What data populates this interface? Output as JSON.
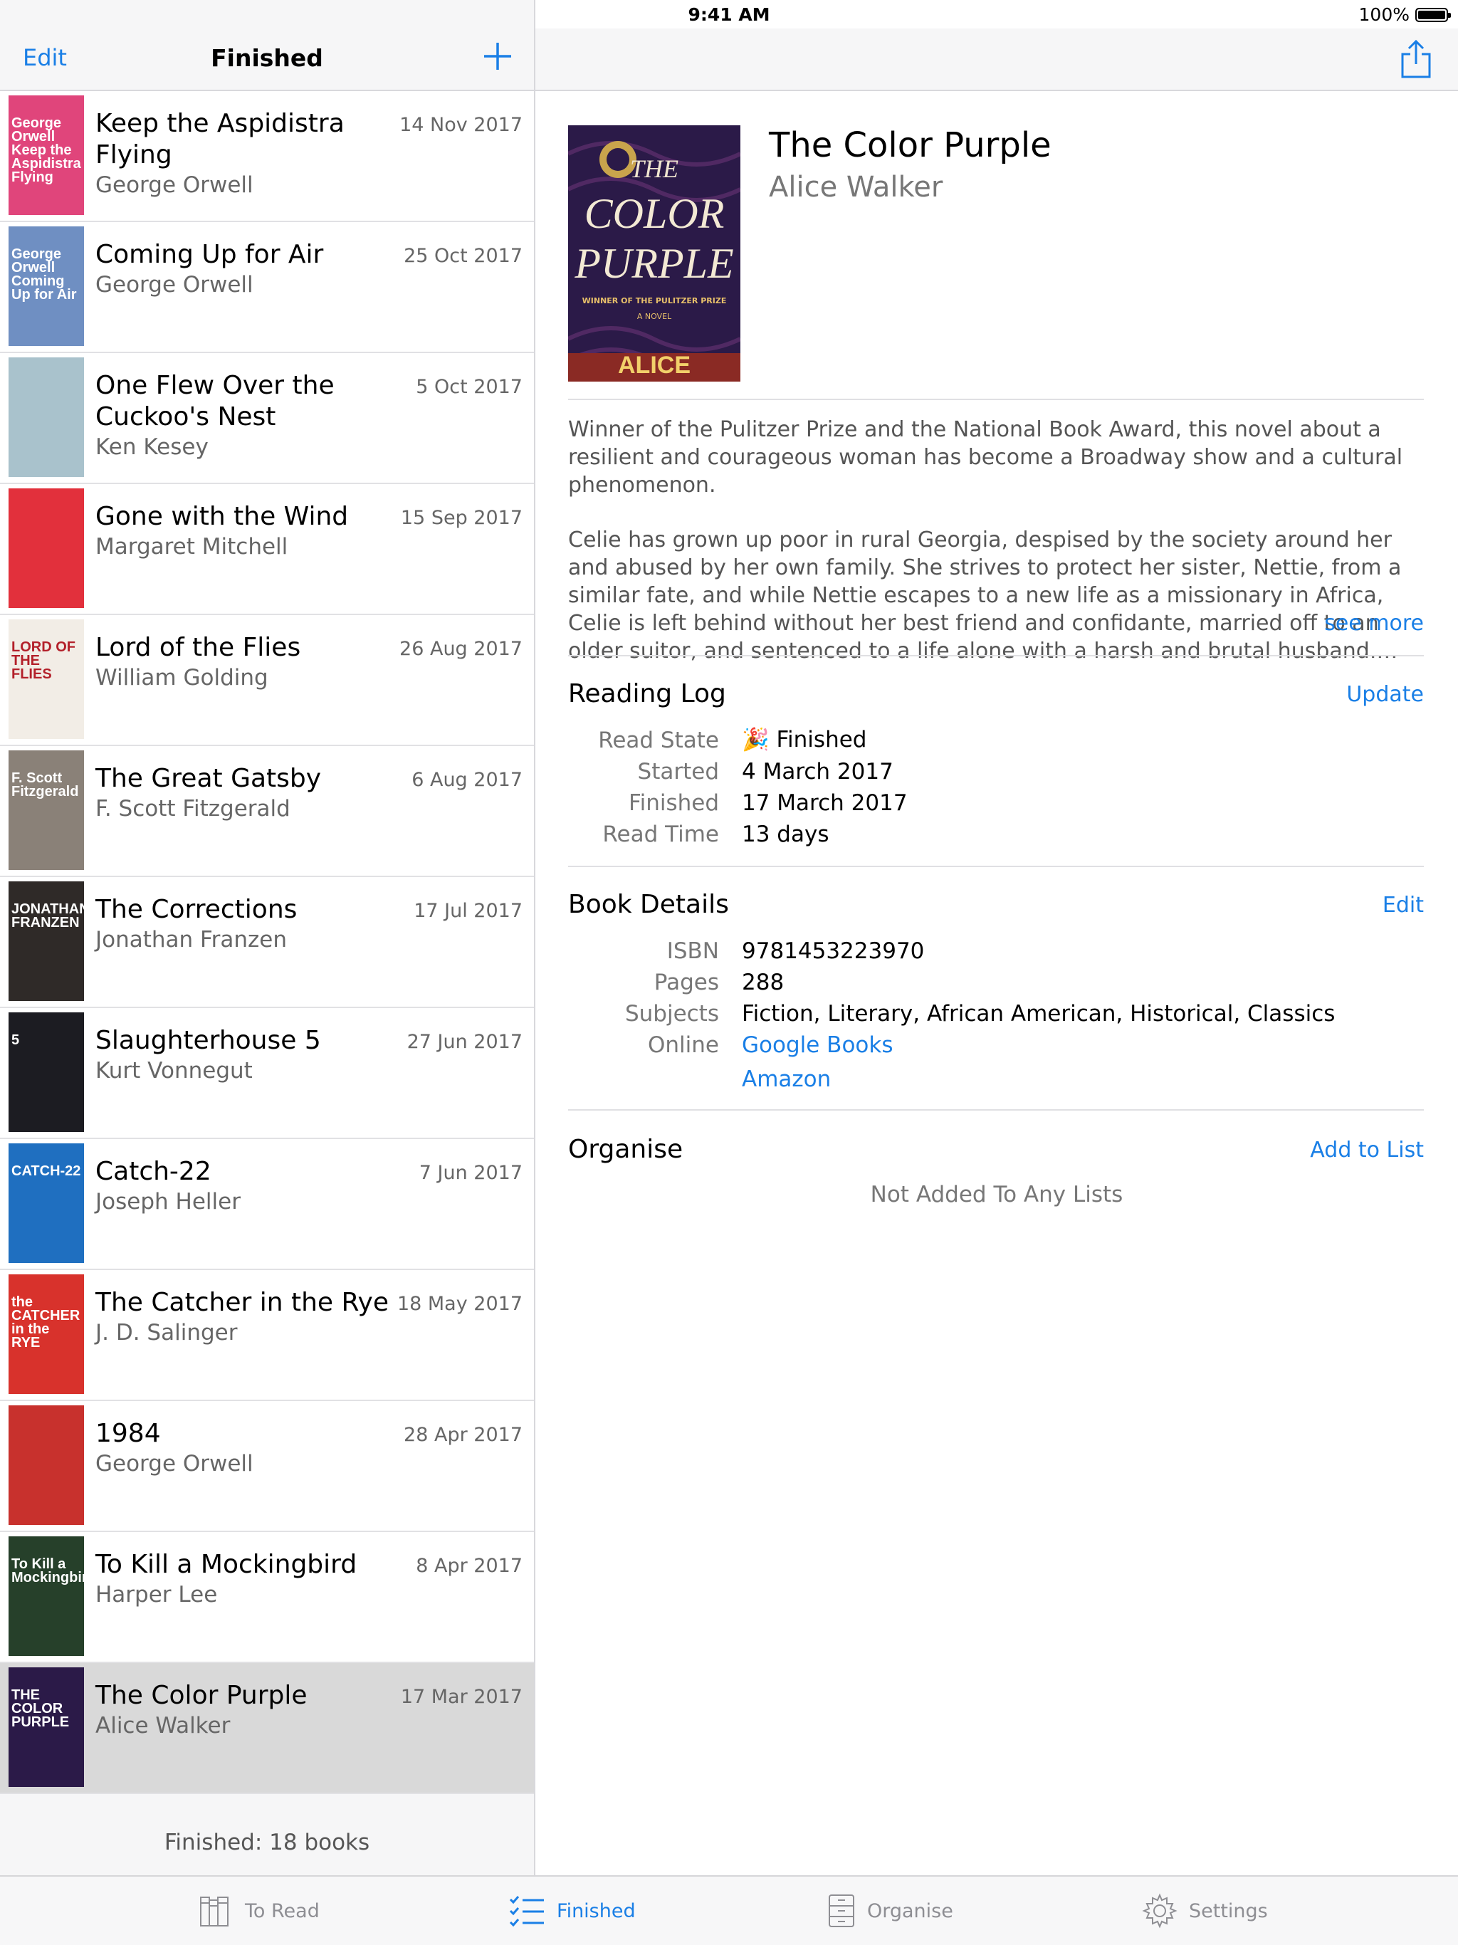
{
  "status_bar": {
    "device": "iPad",
    "time": "9:41 AM",
    "battery": "100%"
  },
  "master": {
    "nav": {
      "edit_label": "Edit",
      "title": "Finished",
      "add_icon": "plus-icon"
    },
    "books": [
      {
        "title": "Keep the Aspidistra Flying",
        "author": "George Orwell",
        "date": "14 Nov 2017",
        "cover_text": "George Orwell Keep the Aspidistra Flying",
        "cover_color": "#e0457b"
      },
      {
        "title": "Coming Up for Air",
        "author": "George Orwell",
        "date": "25 Oct 2017",
        "cover_text": "George Orwell Coming Up for Air",
        "cover_color": "#6f8fc2"
      },
      {
        "title": "One Flew Over the Cuckoo's Nest",
        "author": "Ken Kesey",
        "date": "5 Oct 2017",
        "cover_text": "",
        "cover_color": "#a9c2cc"
      },
      {
        "title": "Gone with the Wind",
        "author": "Margaret Mitchell",
        "date": "15 Sep 2017",
        "cover_text": "",
        "cover_color": "#e2303c"
      },
      {
        "title": "Lord of the Flies",
        "author": "William Golding",
        "date": "26 Aug 2017",
        "cover_text": "LORD OF THE FLIES",
        "cover_color": "#f2ede6"
      },
      {
        "title": "The Great Gatsby",
        "author": "F. Scott Fitzgerald",
        "date": "6 Aug 2017",
        "cover_text": "F. Scott Fitzgerald",
        "cover_color": "#8a8178"
      },
      {
        "title": "The Corrections",
        "author": "Jonathan Franzen",
        "date": "17 Jul 2017",
        "cover_text": "JONATHAN FRANZEN",
        "cover_color": "#2f2a28"
      },
      {
        "title": "Slaughterhouse 5",
        "author": "Kurt Vonnegut",
        "date": "27 Jun 2017",
        "cover_text": "5",
        "cover_color": "#1c1c22"
      },
      {
        "title": "Catch-22",
        "author": "Joseph Heller",
        "date": "7 Jun 2017",
        "cover_text": "CATCH-22",
        "cover_color": "#1f6fc0"
      },
      {
        "title": "The Catcher in the Rye",
        "author": "J. D. Salinger",
        "date": "18 May 2017",
        "cover_text": "the CATCHER in the RYE",
        "cover_color": "#d8322c"
      },
      {
        "title": "1984",
        "author": "George Orwell",
        "date": "28 Apr 2017",
        "cover_text": "",
        "cover_color": "#c8312d"
      },
      {
        "title": "To Kill a Mockingbird",
        "author": "Harper Lee",
        "date": "8 Apr 2017",
        "cover_text": "To Kill a Mockingbird",
        "cover_color": "#26402a"
      },
      {
        "title": "The Color Purple",
        "author": "Alice Walker",
        "date": "17 Mar 2017",
        "cover_text": "THE COLOR PURPLE",
        "cover_color": "#2b1a48",
        "selected": true
      }
    ],
    "footer": "Finished: 18 books"
  },
  "detail": {
    "title": "The Color Purple",
    "author": "Alice Walker",
    "cover": {
      "line1": "THE",
      "line2": "COLOR",
      "line3": "PURPLE",
      "tagline": "WINNER OF THE PULITZER PRIZE",
      "kind": "A NOVEL",
      "author": "ALICE WALKER"
    },
    "description_p1": "Winner of the Pulitzer Prize and the National Book Award, this novel about a resilient and courageous woman has become a Broadway show and a cultural phenomenon.",
    "description_p2": "Celie has grown up poor in rural Georgia, despised by the society around her and abused by her own family. She strives to protect her sister, Nettie, from a similar fate, and while Nettie escapes to a new life as a missionary in Africa, Celie is left behind without her best friend and confidante, married off to an older suitor, and sentenced to a life alone with a harsh and brutal husband.…",
    "see_more": "see more",
    "reading_log": {
      "title": "Reading Log",
      "action": "Update",
      "read_state_label": "Read State",
      "read_state_value": "Finished",
      "read_state_icon": "🎉",
      "started_label": "Started",
      "started_value": "4 March 2017",
      "finished_label": "Finished",
      "finished_value": "17 March 2017",
      "read_time_label": "Read Time",
      "read_time_value": "13 days"
    },
    "book_details": {
      "title": "Book Details",
      "action": "Edit",
      "isbn_label": "ISBN",
      "isbn_value": "9781453223970",
      "pages_label": "Pages",
      "pages_value": "288",
      "subjects_label": "Subjects",
      "subjects_value": "Fiction, Literary, African American, Historical, Classics",
      "online_label": "Online",
      "online_link1": "Google Books",
      "online_link2": "Amazon"
    },
    "organise": {
      "title": "Organise",
      "action": "Add to List",
      "empty": "Not Added To Any Lists"
    },
    "share_icon": "share-icon"
  },
  "tabbar": {
    "tabs": [
      {
        "label": "To Read",
        "icon": "books-icon"
      },
      {
        "label": "Finished",
        "icon": "checklist-icon",
        "active": true
      },
      {
        "label": "Organise",
        "icon": "cabinet-icon"
      },
      {
        "label": "Settings",
        "icon": "gear-icon"
      }
    ]
  },
  "colors": {
    "accent": "#1a7fe6",
    "selected_row": "#d9d9d9",
    "sidebar_bg": "#f6f6f7"
  }
}
